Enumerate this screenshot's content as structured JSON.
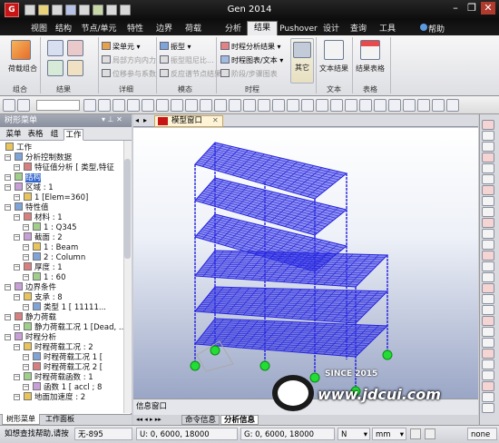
{
  "titlebar": {
    "app_icon": "G",
    "title": "Gen 2014",
    "minimize": "–",
    "restore": "❐",
    "close": "✕"
  },
  "menu_tabs": [
    "视图",
    "结构",
    "节点/单元",
    "特性",
    "边界",
    "荷载",
    "分析",
    "结果",
    "Pushover",
    "设计",
    "查询",
    "工具"
  ],
  "active_tab": "结果",
  "help_label": "帮助",
  "ribbon": {
    "groups": [
      "组合",
      "结果",
      "详细",
      "模态",
      "时程",
      "文本",
      "表格"
    ],
    "load_combo": "荷载组合",
    "detail": {
      "item1": "梁单元",
      "item2": "局部方向内力",
      "item3": "位移参与系数"
    },
    "modal": {
      "item1": "振型",
      "item2": "振型阻尼比...",
      "item3": "反应谱节点结果"
    },
    "time_history": {
      "item1": "时程分析结果",
      "item2": "时程图表/文本",
      "item3": "阶段/步骤图表"
    },
    "other": "其它",
    "text_result": "文本结果",
    "result_table": "结果表格"
  },
  "panel": {
    "title": "树形菜单",
    "pin": "▾ ⊥ ✕",
    "tabs": [
      "菜单",
      "表格",
      "组",
      "工作"
    ],
    "active_tab": "工作",
    "tree": [
      {
        "label": "工作",
        "depth": 0
      },
      {
        "label": "分析控制数据",
        "depth": 1
      },
      {
        "label": "特征值分析 [ 类型,特征",
        "depth": 2
      },
      {
        "label": "结构",
        "depth": 1,
        "selected": true
      },
      {
        "label": "区域 : 1",
        "depth": 1
      },
      {
        "label": "1 [Elem=360]",
        "depth": 2
      },
      {
        "label": "特性值",
        "depth": 1
      },
      {
        "label": "材料 : 1",
        "depth": 2
      },
      {
        "label": "1 : Q345",
        "depth": 3
      },
      {
        "label": "截面 : 2",
        "depth": 2
      },
      {
        "label": "1 : Beam",
        "depth": 3
      },
      {
        "label": "2 : Column",
        "depth": 3
      },
      {
        "label": "厚度 : 1",
        "depth": 2
      },
      {
        "label": "1 : 60",
        "depth": 3
      },
      {
        "label": "边界条件",
        "depth": 1
      },
      {
        "label": "支承 : 8",
        "depth": 2
      },
      {
        "label": "类型 1 [ 11111...",
        "depth": 3
      },
      {
        "label": "静力荷载",
        "depth": 1
      },
      {
        "label": "静力荷载工况 1 [Dead, ...",
        "depth": 2
      },
      {
        "label": "时程分析",
        "depth": 1
      },
      {
        "label": "时程荷载工况 : 2",
        "depth": 2
      },
      {
        "label": "时程荷载工况 1 [",
        "depth": 3
      },
      {
        "label": "时程荷载工况 2 [",
        "depth": 3
      },
      {
        "label": "时程荷载函数 : 1",
        "depth": 2
      },
      {
        "label": "函数 1 [ accl ; 8",
        "depth": 3
      },
      {
        "label": "地面加速度 : 2",
        "depth": 2
      }
    ],
    "footer_tabs": [
      "树形菜单",
      "工作面板"
    ]
  },
  "document": {
    "tab_label": "模型窗口",
    "close": "✕",
    "nav_left": "◂",
    "nav_right": "▸"
  },
  "message": {
    "title": "信息窗口",
    "tabs": [
      "命令信息",
      "分析信息"
    ],
    "active_tab": "分析信息"
  },
  "status": {
    "hint": "如想查找帮助,请按",
    "node": "无-895",
    "coord_u": "U: 0, 6000, 18000",
    "coord_g": "G: 0, 6000, 18000",
    "force_unit": "N",
    "length_unit": "mm",
    "zoom": "none"
  },
  "watermark": {
    "since": "SINCE 2015",
    "site": "www.jdcui.com"
  },
  "colors": {
    "structure": "#2222dd",
    "support": "#22dd33",
    "accent": "#c81414"
  }
}
